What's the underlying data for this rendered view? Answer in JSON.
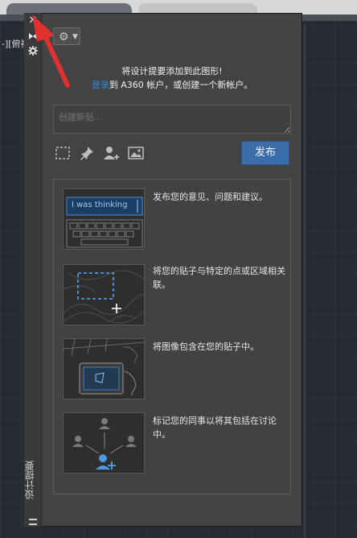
{
  "background": {
    "cad_label": "-][俯视"
  },
  "palette": {
    "title": "设计提要",
    "intro_line1": "将设计提要添加到此图形!",
    "intro_line2_link": "登录",
    "intro_line2_rest": "到 A360 帐户，或创建一个新帐户。",
    "post_placeholder": "创建新贴...",
    "publish_label": "发布",
    "strip_icons": [
      "close-icon",
      "autohide-icon",
      "properties-icon"
    ],
    "help": [
      {
        "icon": "keyboard-thinking",
        "illus_text": "I was thinking",
        "text": "发布您的意见、问题和建议。"
      },
      {
        "icon": "selection-area",
        "text": "将您的贴子与特定的点或区域相关联。"
      },
      {
        "icon": "image-tablet",
        "text": "将图像包含在您的贴子中。"
      },
      {
        "icon": "tag-people",
        "text": "标记您的同事以将其包括在讨论中。"
      }
    ]
  },
  "colors": {
    "accent_link": "#2f88d6",
    "publish_bg": "#3b6ea8",
    "annotation_arrow": "#e03030"
  }
}
